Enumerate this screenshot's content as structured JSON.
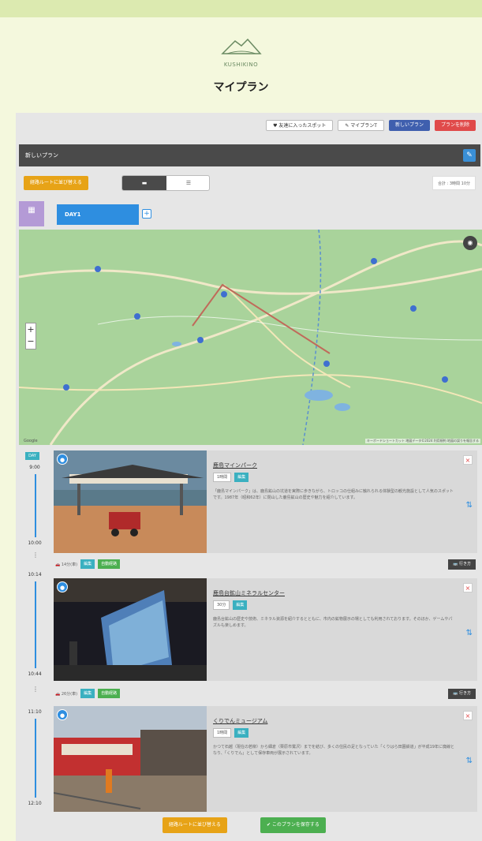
{
  "brand": {
    "name": "KUSHIKINO",
    "page_title": "マイプラン"
  },
  "toolbar": {
    "favorites_label": "♥ 友達に入ったスポット",
    "myplan_label": "✎ マイプランT",
    "new_plan_label": "新しいプラン",
    "delete_plan_label": "プランを削除"
  },
  "plan": {
    "title": "新しいプラン",
    "route_button": "経路ルートに並び替える",
    "view_toggle": [
      "▬",
      "☰"
    ],
    "time_summary": "合計 : 3時間 10分"
  },
  "days": {
    "calendar_label": "calendar",
    "tabs": [
      "DAY1"
    ],
    "add_label": "+"
  },
  "map": {
    "zoom_in": "+",
    "zoom_out": "−",
    "attribution": "キーボードショートカット 地図データ©2024 利用規約 地図の誤りを報告する",
    "google_label": "Google"
  },
  "timeline": {
    "day_badge": "DAY",
    "times": [
      "9:00",
      "10:00",
      "10:14",
      "10:44",
      "11:10",
      "12:10"
    ]
  },
  "spots": [
    {
      "title": "鹿島マインパーク",
      "duration": "1時間",
      "edit": "編集",
      "description": "「鹿島マインパーク」は、鹿島鉱山の坑道を実際に歩きながら、トロッコの仕組みに触れられる体験型の観光施設として人気のスポットです。1987年（昭和62年）に閉山した鹿島鉱山の歴史や魅力を紹介しています。"
    },
    {
      "title": "鹿島台鉱山ミネラルセンター",
      "duration": "30分",
      "edit": "編集",
      "description": "鹿島台鉱山の歴史や技術、ミネラル資源を紹介するとともに、市内の鉱物展示の場としても利用されております。そのほか、ゲームやパズルも楽しめます。"
    },
    {
      "title": "くりでんミュージアム",
      "duration": "1時間",
      "edit": "編集",
      "description": "かつて石越（現在の若柳）から細倉（栗原市鶯沢）までを結び、多くの住民の足となっていた「くりはら田園鉄道」が平成19年に廃線となり、「くりでん」として保存車両が展示されています。"
    }
  ],
  "transits": [
    {
      "time": "🚗 14分(車)",
      "edit": "編集",
      "auto": "自動経路",
      "right": "🚌 行き方"
    },
    {
      "time": "🚗 26分(車)",
      "edit": "編集",
      "auto": "自動経路",
      "right": "🚌 行き方"
    }
  ],
  "bottom": {
    "route_button": "経路ルートに並び替える",
    "save_button": "✔ このプランを保存する"
  },
  "colors": {
    "accent_blue": "#2e8ee0",
    "orange": "#e7a317",
    "green": "#4caf50",
    "teal": "#3ab0c0",
    "red": "#e04a4a"
  }
}
